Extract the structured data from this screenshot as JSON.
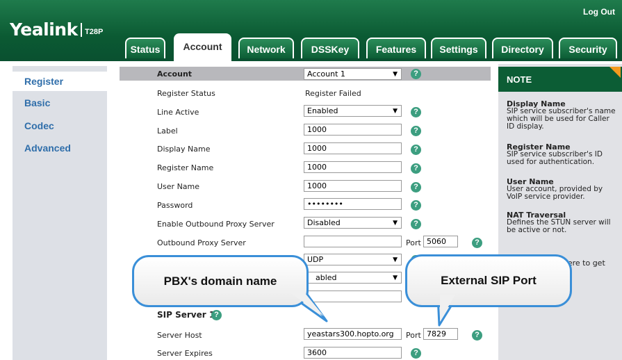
{
  "header": {
    "brand": "Yealink",
    "model": "T28P",
    "logout": "Log Out"
  },
  "tabs": [
    {
      "label": "Status"
    },
    {
      "label": "Account"
    },
    {
      "label": "Network"
    },
    {
      "label": "DSSKey"
    },
    {
      "label": "Features"
    },
    {
      "label": "Settings"
    },
    {
      "label": "Directory"
    },
    {
      "label": "Security"
    }
  ],
  "sidebar": {
    "items": [
      {
        "label": "Register"
      },
      {
        "label": "Basic"
      },
      {
        "label": "Codec"
      },
      {
        "label": "Advanced"
      }
    ]
  },
  "form": {
    "account_label": "Account",
    "account_value": "Account 1",
    "register_status_label": "Register Status",
    "register_status_value": "Register Failed",
    "line_active_label": "Line Active",
    "line_active_value": "Enabled",
    "label_label": "Label",
    "label_value": "1000",
    "display_name_label": "Display Name",
    "display_name_value": "1000",
    "register_name_label": "Register Name",
    "register_name_value": "1000",
    "user_name_label": "User Name",
    "user_name_value": "1000",
    "password_label": "Password",
    "password_value": "••••••••",
    "outbound_enable_label": "Enable Outbound Proxy Server",
    "outbound_enable_value": "Disabled",
    "outbound_server_label": "Outbound Proxy Server",
    "outbound_server_value": "",
    "port_label": "Port",
    "outbound_port_value": "5060",
    "transport_value": "UDP",
    "nat_value": "abled",
    "sip_server_heading": "SIP Server 1",
    "server_host_label": "Server Host",
    "server_host_value": "yeastars300.hopto.org",
    "server_port_value": "7829",
    "server_expires_label": "Server Expires",
    "server_expires_value": "3600",
    "help_symbol": "?",
    "dropdown_arrow": "▼"
  },
  "note": {
    "title": "NOTE",
    "entries": [
      {
        "heading": "Display Name",
        "text": "SIP service subscriber's name which will be used for Caller ID display."
      },
      {
        "heading": "Register Name",
        "text": "SIP service subscriber's ID used for authentication."
      },
      {
        "heading": "User Name",
        "text": "User account, provided by VoIP service provider."
      },
      {
        "heading": "NAT Traversal",
        "text": "Defines the STUN server will be active or not."
      }
    ],
    "partial_text": "k here to get"
  },
  "callouts": {
    "domain": "PBX's domain name",
    "port": "External SIP Port"
  },
  "colors": {
    "header_green": "#0b5a33",
    "bubble_border": "#3a8fd8",
    "help_icon": "#3c9e80",
    "note_corner": "#f39a1e"
  }
}
